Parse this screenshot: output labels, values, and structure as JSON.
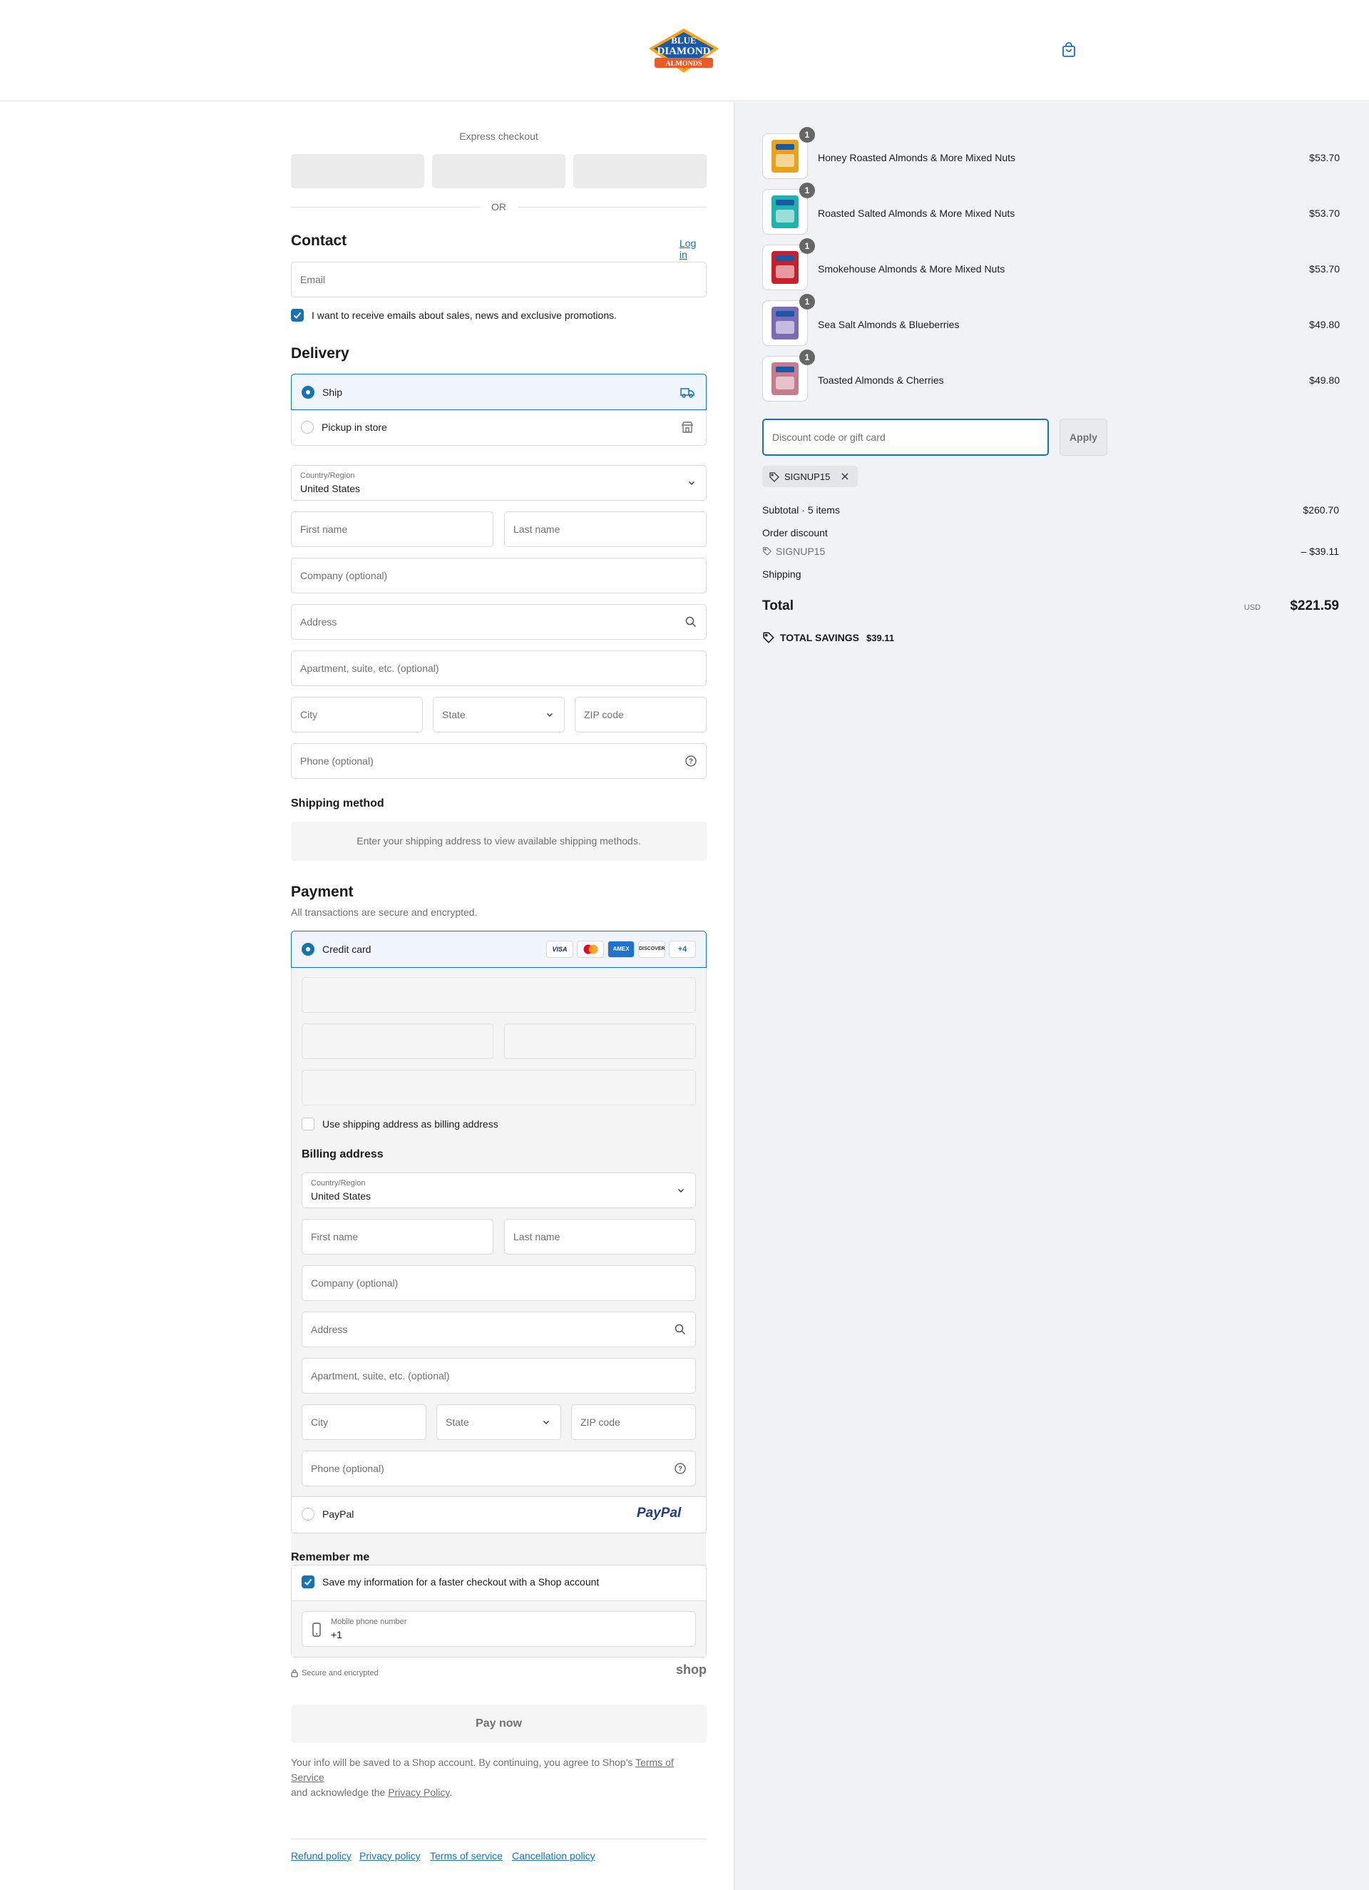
{
  "brand": {
    "logo_line1": "BLUE",
    "logo_line2": "DIAMOND",
    "logo_line3": "ALMONDS"
  },
  "express": {
    "title": "Express checkout",
    "or": "OR"
  },
  "contact": {
    "title": "Contact",
    "login": "Log in",
    "email_placeholder": "Email",
    "marketing_label": "I want to receive emails about sales, news and exclusive promotions."
  },
  "delivery": {
    "title": "Delivery",
    "ship": "Ship",
    "pickup": "Pickup in store",
    "country_label": "Country/Region",
    "country_value": "United States",
    "first_name": "First name",
    "last_name": "Last name",
    "company": "Company (optional)",
    "address": "Address",
    "apartment": "Apartment, suite, etc. (optional)",
    "city": "City",
    "state": "State",
    "zip": "ZIP code",
    "phone": "Phone (optional)"
  },
  "shipping_method": {
    "title": "Shipping method",
    "notice": "Enter your shipping address to view available shipping methods."
  },
  "payment": {
    "title": "Payment",
    "subtitle": "All transactions are secure and encrypted.",
    "credit_card": "Credit card",
    "cards": [
      "VISA",
      "MC",
      "AMEX",
      "DISCOVER"
    ],
    "more_cards": "+4",
    "same_billing": "Use shipping address as billing address",
    "billing_title": "Billing address",
    "paypal": "PayPal",
    "paypal_logo": "PayPal"
  },
  "billing": {
    "country_label": "Country/Region",
    "country_value": "United States",
    "first_name": "First name",
    "last_name": "Last name",
    "company": "Company (optional)",
    "address": "Address",
    "apartment": "Apartment, suite, etc. (optional)",
    "city": "City",
    "state": "State",
    "zip": "ZIP code",
    "phone": "Phone (optional)"
  },
  "remember": {
    "title": "Remember me",
    "save_label": "Save my information for a faster checkout with a Shop account",
    "mobile_label": "Mobile phone number",
    "mobile_value": "+1",
    "secure": "Secure and encrypted",
    "shop_logo": "shop"
  },
  "pay_now": "Pay now",
  "legal": {
    "text1": "Your info will be saved to a Shop account. By continuing, you agree to Shop’s ",
    "tos": "Terms of Service",
    "text2": "and acknowledge the ",
    "privacy": "Privacy Policy",
    "text3": "."
  },
  "footer_links": [
    "Refund policy",
    "Privacy policy",
    "Terms of service",
    "Cancellation policy"
  ],
  "cart": {
    "items": [
      {
        "name": "Honey Roasted Almonds & More Mixed Nuts",
        "price": "$53.70",
        "qty": "1",
        "color": "#e8a21c"
      },
      {
        "name": "Roasted Salted Almonds & More Mixed Nuts",
        "price": "$53.70",
        "qty": "1",
        "color": "#1fb3ab"
      },
      {
        "name": "Smokehouse Almonds & More Mixed Nuts",
        "price": "$53.70",
        "qty": "1",
        "color": "#c8202a"
      },
      {
        "name": "Sea Salt Almonds & Blueberries",
        "price": "$49.80",
        "qty": "1",
        "color": "#7a6bb5"
      },
      {
        "name": "Toasted Almonds & Cherries",
        "price": "$49.80",
        "qty": "1",
        "color": "#c77b8e"
      }
    ],
    "discount_placeholder": "Discount code or gift card",
    "apply": "Apply",
    "code_tag": "SIGNUP15",
    "subtotal_label": "Subtotal · 5 items",
    "subtotal_value": "$260.70",
    "order_discount_label": "Order discount",
    "discount_code": "SIGNUP15",
    "discount_value": "– $39.11",
    "shipping_label": "Shipping",
    "total_label": "Total",
    "currency": "USD",
    "total_value": "$221.59",
    "savings_label": "TOTAL SAVINGS",
    "savings_value": "$39.11"
  },
  "colors": {
    "accent": "#1773b0",
    "sidebar_bg": "#f0f2f6"
  }
}
